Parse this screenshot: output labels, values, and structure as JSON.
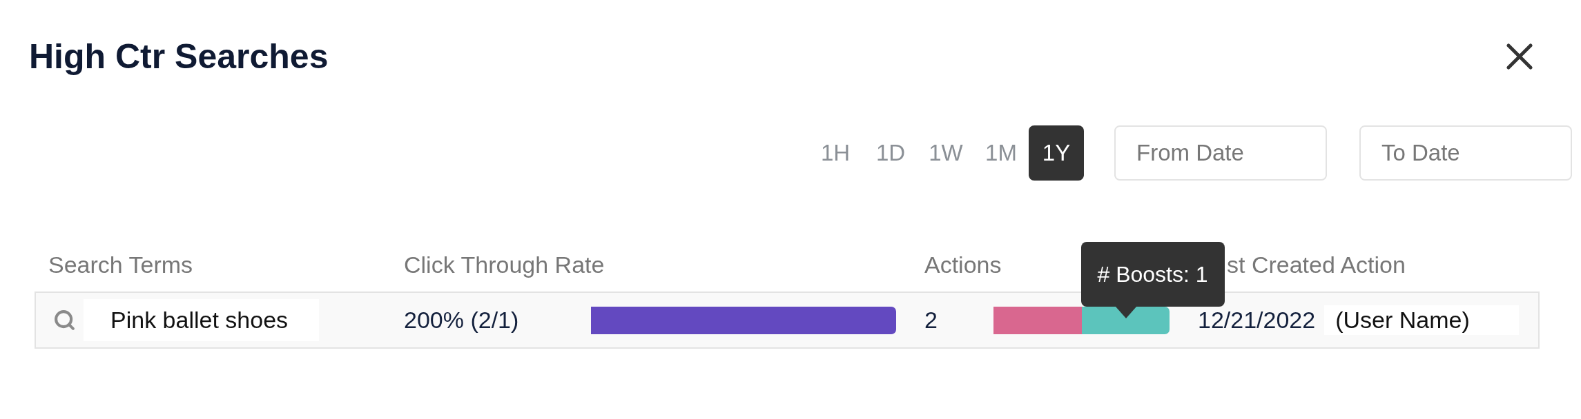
{
  "dialog": {
    "title": "High Ctr Searches"
  },
  "time_ranges": [
    {
      "label": "1H",
      "selected": false
    },
    {
      "label": "1D",
      "selected": false
    },
    {
      "label": "1W",
      "selected": false
    },
    {
      "label": "1M",
      "selected": false
    },
    {
      "label": "1Y",
      "selected": true
    }
  ],
  "date_filters": [
    {
      "placeholder": "From Date"
    },
    {
      "placeholder": "To Date"
    }
  ],
  "table": {
    "columns": [
      "Search Terms",
      "Click Through Rate",
      "Actions",
      "st Created Action"
    ],
    "rows": [
      {
        "search_term": "Pink ballet shoes",
        "ctr": "200% (2/1)",
        "ctr_bar": {
          "level": 1
        },
        "actions": "2",
        "action_segments": [
          {
            "color": "#d9678f",
            "level": 0.5
          },
          {
            "color": "#5cc4bc",
            "level": 0.5,
            "tooltip": "# Boosts: 1"
          }
        ],
        "last_action_date": "12/21/2022",
        "user": "(User Name)"
      }
    ]
  }
}
